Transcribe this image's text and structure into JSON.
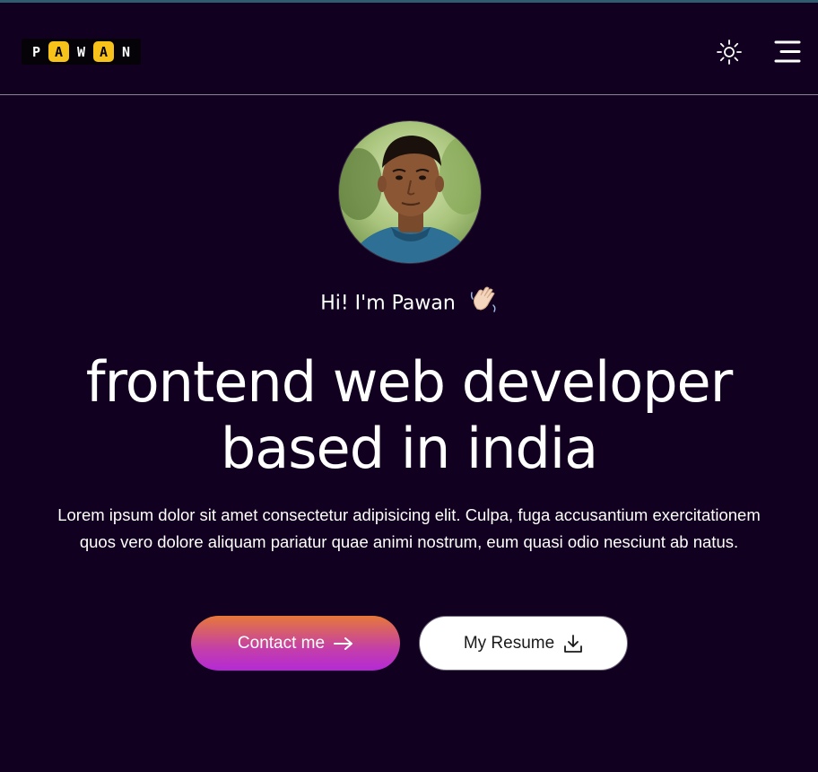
{
  "header": {
    "logo": {
      "letters": [
        "P",
        "A",
        "W",
        "A",
        "N"
      ],
      "logo_colors": {
        "highlight": "#f7c21a",
        "background": "#050308"
      }
    },
    "theme_toggle_icon": "sun-icon",
    "menu_icon": "hamburger-menu-icon"
  },
  "hero": {
    "avatar_alt": "profile photo",
    "greeting": "Hi! I'm Pawan",
    "greeting_emoji": "waving-hand-emoji",
    "headline_line1": "frontend web developer",
    "headline_line2": "based in india",
    "description": "Lorem ipsum dolor sit amet consectetur adipisicing elit. Culpa, fuga accusantium exercitationem quos vero dolore aliquam pariatur quae animi nostrum, eum quasi odio nesciunt ab natus.",
    "buttons": {
      "contact": {
        "label": "Contact me",
        "icon": "arrow-right-icon"
      },
      "resume": {
        "label": "My Resume",
        "icon": "download-icon"
      }
    }
  },
  "colors": {
    "background": "#11001f",
    "contact_gradient_top": "#e6783a",
    "contact_gradient_bottom": "#b42ad6",
    "text": "#ffffff"
  }
}
